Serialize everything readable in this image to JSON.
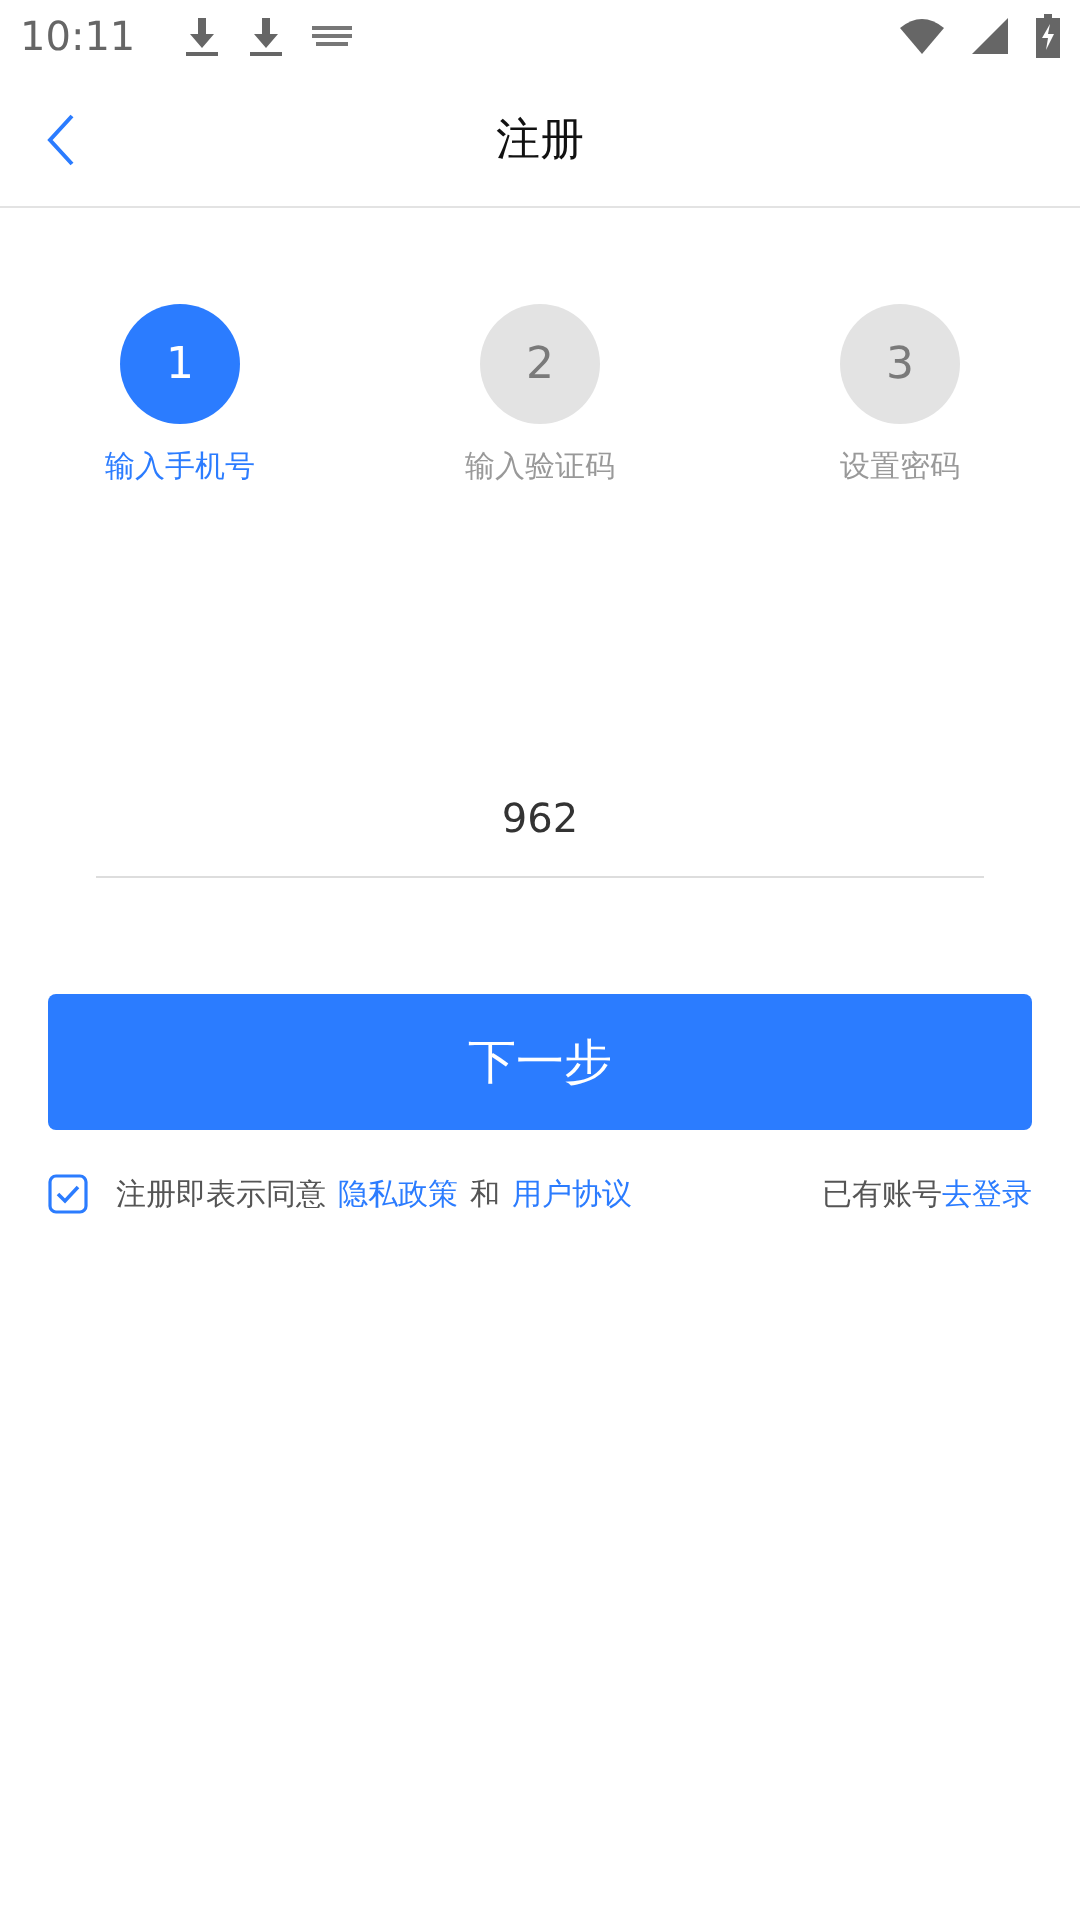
{
  "status_bar": {
    "time": "10:11"
  },
  "header": {
    "title": "注册"
  },
  "steps": [
    {
      "number": "1",
      "label": "输入手机号",
      "selected": true
    },
    {
      "number": "2",
      "label": "输入验证码",
      "selected": false
    },
    {
      "number": "3",
      "label": "设置密码",
      "selected": false
    }
  ],
  "phone_field": {
    "value": "962"
  },
  "next_button": "下一步",
  "agreement": {
    "checked": true,
    "text": "注册即表示同意",
    "privacy_link": "隐私政策",
    "joiner": "和",
    "terms_link": "用户协议"
  },
  "login": {
    "text": "已有账号",
    "link": "去登录"
  }
}
